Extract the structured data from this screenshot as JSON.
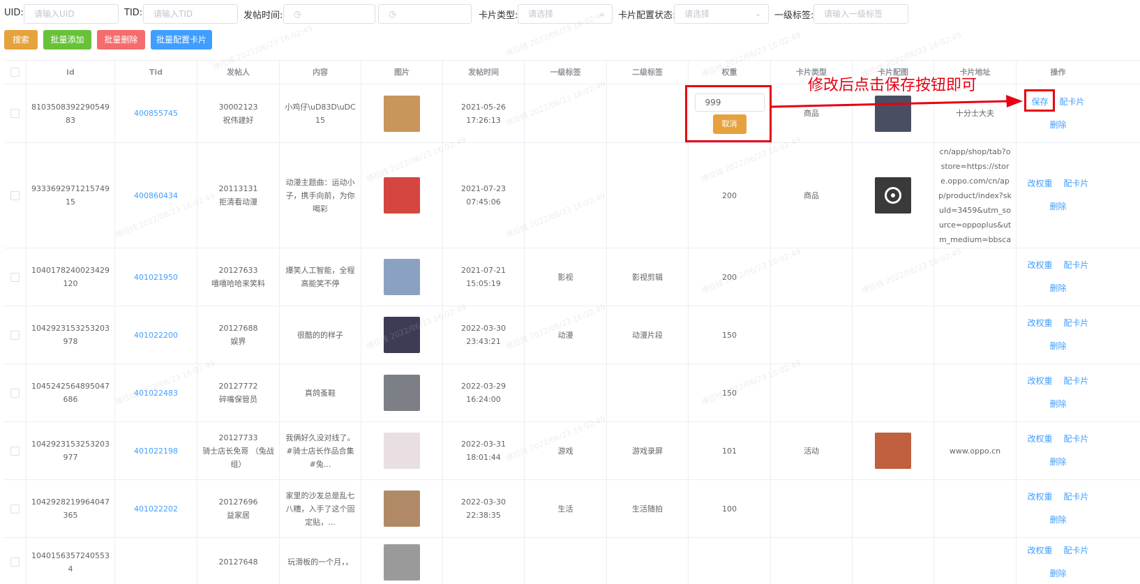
{
  "filters": {
    "uid_label": "UID:",
    "uid_placeholder": "请输入UID",
    "tid_label": "TID:",
    "tid_placeholder": "请输入TID",
    "posttime_label": "发帖时间:",
    "cardtype_label": "卡片类型:",
    "cardtype_placeholder": "请选择",
    "cardstatus_label": "卡片配置状态:",
    "cardstatus_placeholder": "请选择",
    "tag1_label": "一级标签:",
    "tag1_placeholder": "请输入一级标签"
  },
  "buttons": {
    "search": "搜索",
    "batch_add": "批量添加",
    "batch_delete": "批量删除",
    "batch_config": "批量配置卡片"
  },
  "table": {
    "headers": [
      "id",
      "Tid",
      "发帖人",
      "内容",
      "图片",
      "发帖时间",
      "一级标签",
      "二级标签",
      "权重",
      "卡片类型",
      "卡片配图",
      "卡片地址",
      "操作"
    ],
    "rows": [
      {
        "id": "810350839229054983",
        "tid": "400855745",
        "poster_id": "30002123",
        "poster_name": "祝伟建好",
        "content": "小鸡仔\\uD83D\\uDC15",
        "time": "2021-05-26 17:26:13",
        "tag1": "",
        "tag2": "",
        "weight": "999",
        "card_type": "商品",
        "card_url": "十分士大夫",
        "thumb_color": "#c8955a",
        "card_img_color": "#4a4e63",
        "editing": true
      },
      {
        "id": "933369297121574915",
        "tid": "400860434",
        "poster_id": "20113131",
        "poster_name": "拒清看动漫",
        "content": "动漫主题曲：运动小子，携手向前，为你喝彩",
        "time": "2021-07-23 07:45:06",
        "tag1": "",
        "tag2": "",
        "weight": "200",
        "card_type": "商品",
        "card_url": "https://www.oppo.cn/app/shop/tab?ostore=https://store.oppo.com/cn/app/product/index?skuId=3459&utm_source=oppoplus&utm_medium=bbscard",
        "thumb_color": "#d4463f",
        "card_img_color": "#3a3a3a"
      },
      {
        "id": "1040178240023429120",
        "tid": "401021950",
        "poster_id": "20127633",
        "poster_name": "嘻嘻哈哈来笑料",
        "content": "爆笑人工智能，全程高能笑不停",
        "time": "2021-07-21 15:05:19",
        "tag1": "影视",
        "tag2": "影视剪辑",
        "weight": "200",
        "card_type": "",
        "card_url": "",
        "thumb_color": "#8aa1c1",
        "card_img_color": ""
      },
      {
        "id": "1042923153253203978",
        "tid": "401022200",
        "poster_id": "20127688",
        "poster_name": "娱界",
        "content": "很酷的的样子",
        "time": "2022-03-30 23:43:21",
        "tag1": "动漫",
        "tag2": "动漫片段",
        "weight": "150",
        "card_type": "",
        "card_url": "",
        "thumb_color": "#3d3b55",
        "card_img_color": ""
      },
      {
        "id": "1045242564895047686",
        "tid": "401022483",
        "poster_id": "20127772",
        "poster_name": "碎嘴保管员",
        "content": "真鸽蚤鞋",
        "time": "2022-03-29 16:24:00",
        "tag1": "",
        "tag2": "",
        "weight": "150",
        "card_type": "",
        "card_url": "",
        "thumb_color": "#7c7f86",
        "card_img_color": ""
      },
      {
        "id": "1042923153253203977",
        "tid": "401022198",
        "poster_id": "20127733",
        "poster_name": "骑士店长免哥 （兔战组）",
        "content": "我俩好久没对线了。#骑士店长作品合集 #兔...",
        "time": "2022-03-31 18:01:44",
        "tag1": "游戏",
        "tag2": "游戏录屏",
        "weight": "101",
        "card_type": "活动",
        "card_url": "www.oppo.cn",
        "thumb_color": "#e9dfe3",
        "card_img_color": "#c0603e"
      },
      {
        "id": "1042928219964047365",
        "tid": "401022202",
        "poster_id": "20127696",
        "poster_name": "益家居",
        "content": "家里的沙发总是乱七八糟，入手了这个固定贴，...",
        "time": "2022-03-30 22:38:35",
        "tag1": "生活",
        "tag2": "生活随拍",
        "weight": "100",
        "card_type": "",
        "card_url": "",
        "thumb_color": "#b08a66",
        "card_img_color": ""
      },
      {
        "id": "1040156357240553 4",
        "tid": "",
        "poster_id": "20127648",
        "poster_name": "",
        "content": "玩滑板的一个月，，",
        "time": "",
        "tag1": "",
        "tag2": "",
        "weight": "",
        "card_type": "",
        "card_url": "",
        "thumb_color": "#9a9a9a",
        "card_img_color": ""
      }
    ]
  },
  "ops": {
    "save": "保存",
    "config_card": "配卡片",
    "delete": "删除",
    "change_weight": "改权重",
    "cancel": "取消"
  },
  "annotation": {
    "text": "修改后点击保存按钮即可"
  },
  "watermark": "维拉线 2022/06/23 16:02:49",
  "colors": {
    "primary": "#409eff",
    "warning": "#e6a23c",
    "success": "#67c23a",
    "danger": "#f56c6c",
    "annotation_red": "#e60012"
  }
}
